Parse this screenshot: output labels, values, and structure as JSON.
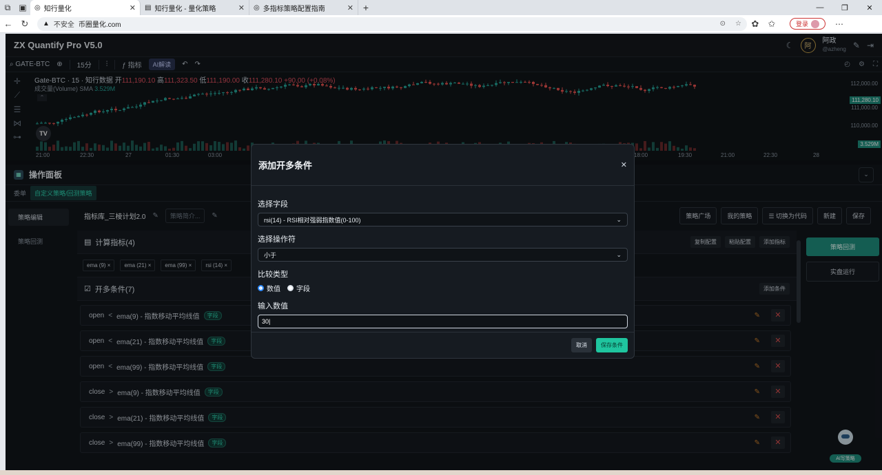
{
  "browser": {
    "tabs": [
      {
        "title": "知行量化",
        "active": true
      },
      {
        "title": "知行量化 - 量化策略",
        "active": false
      },
      {
        "title": "多指标策略配置指南",
        "active": false
      }
    ],
    "security_label": "不安全",
    "url": "币圈量化.com",
    "login_label": "登录"
  },
  "app": {
    "brand": "ZX Quantify Pro V5.0",
    "user": {
      "avatar": "阿",
      "name": "阿政",
      "handle": "@azheng"
    }
  },
  "chart_toolbar": {
    "symbol": "GATE-BTC",
    "interval": "15分",
    "indicator_label": "指标",
    "ai_label": "AI解读"
  },
  "chart": {
    "title": "Gate-BTC · 15 · 知行数据",
    "ohlc": {
      "o_label": "开",
      "o": "111,190.10",
      "h_label": "高",
      "h": "111,323.50",
      "l_label": "低",
      "l": "111,190.00",
      "c_label": "收",
      "c": "111,280.10",
      "chg": "+90.00 (+0.08%)"
    },
    "volume_label": "成交量(Volume)",
    "sma_label": "SMA",
    "sma_value": "3.529M",
    "price_ticks": [
      "112,000.00",
      "111,000.00",
      "110,000.00"
    ],
    "last_price": "111,280.10",
    "vol_tag": "3.529M",
    "time_ticks": [
      "21:00",
      "22:30",
      "27",
      "01:30",
      "03:00",
      "18:00",
      "19:30",
      "21:00",
      "22:30",
      "28"
    ],
    "logo": "TV",
    "colors": {
      "up": "#26a69a",
      "down": "#ef5350"
    }
  },
  "panel": {
    "title": "操作面板",
    "tabs": [
      "委单",
      "自定义策略/回测策略"
    ],
    "leftnav": [
      "策略编辑",
      "策略回测"
    ],
    "strategy_name": "指标库_三棱计划2.0",
    "desc_placeholder": "策略简介...",
    "actions": [
      "策略广场",
      "我的策略",
      "切换为代码",
      "新建",
      "保存"
    ],
    "indicators_title": "计算指标(4)",
    "indicator_actions": [
      "复制配置",
      "粘贴配置",
      "添加指标"
    ],
    "indicators": [
      "ema (9)",
      "ema (21)",
      "ema (99)",
      "rsi (14)"
    ],
    "conditions_title": "开多条件(7)",
    "add_condition": "添加条件",
    "conditions": [
      {
        "left": "open",
        "op": "<",
        "right": "ema(9) - 指数移动平均线值",
        "tag": "字段"
      },
      {
        "left": "open",
        "op": "<",
        "right": "ema(21) - 指数移动平均线值",
        "tag": "字段"
      },
      {
        "left": "open",
        "op": "<",
        "right": "ema(99) - 指数移动平均线值",
        "tag": "字段"
      },
      {
        "left": "close",
        "op": ">",
        "right": "ema(9) - 指数移动平均线值",
        "tag": "字段"
      },
      {
        "left": "close",
        "op": ">",
        "right": "ema(21) - 指数移动平均线值",
        "tag": "字段"
      },
      {
        "left": "close",
        "op": ">",
        "right": "ema(99) - 指数移动平均线值",
        "tag": "字段"
      }
    ],
    "backtest_label": "策略回测",
    "live_label": "实盘运行",
    "ai_bot_label": "AI写策略"
  },
  "modal": {
    "title": "添加开多条件",
    "field_label": "选择字段",
    "field_value": "rsi(14) - RSI相对强弱指数值(0-100)",
    "operator_label": "选择操作符",
    "operator_value": "小于",
    "compare_label": "比较类型",
    "compare_options": [
      "数值",
      "字段"
    ],
    "compare_selected": "数值",
    "input_label": "输入数值",
    "input_value": "30",
    "cancel": "取消",
    "save": "保存条件"
  }
}
